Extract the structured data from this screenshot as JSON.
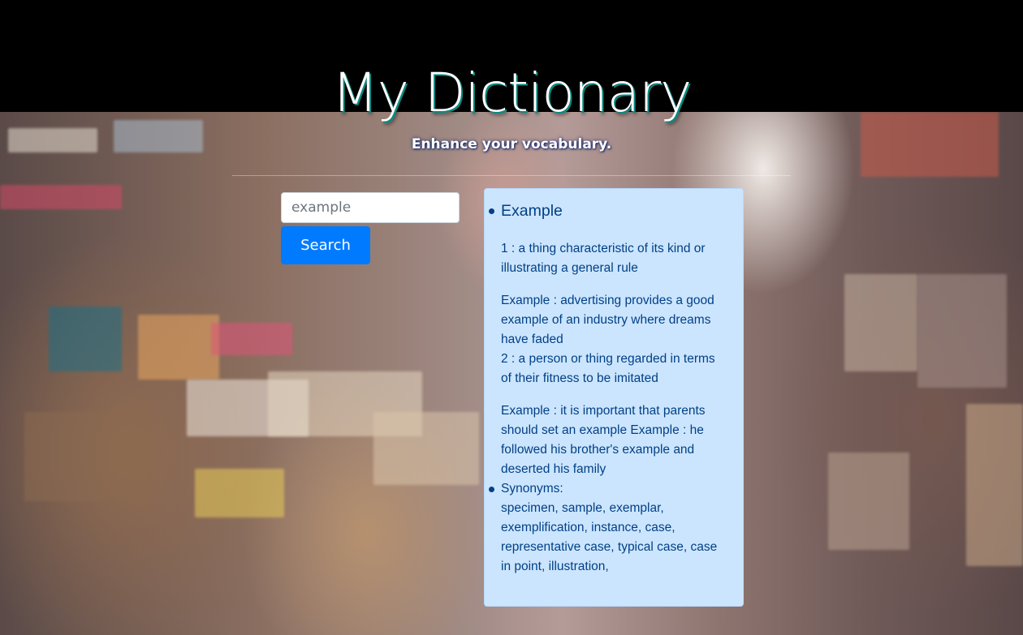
{
  "header": {
    "title": "My Dictionary",
    "subtitle": "Enhance your vocabulary."
  },
  "search": {
    "placeholder": "example",
    "value": "",
    "button_label": "Search"
  },
  "result": {
    "word": "Example",
    "definition_1": "1 : a thing characteristic of its kind or illustrating a general rule",
    "example_1": "Example : advertising provides a good example of an industry where dreams have faded",
    "definition_2": "2 : a person or thing regarded in terms of their fitness to be imitated",
    "example_2": "Example : it is important that parents should set an example Example : he followed his brother's example and deserted his family",
    "synonyms_label": "Synonyms:",
    "synonyms": "specimen, sample, exemplar, exemplification, instance, case, representative case, typical case, case in point, illustration,"
  },
  "colors": {
    "button": "#007bff",
    "panel_bg": "#cce5ff",
    "panel_text": "#004085"
  }
}
